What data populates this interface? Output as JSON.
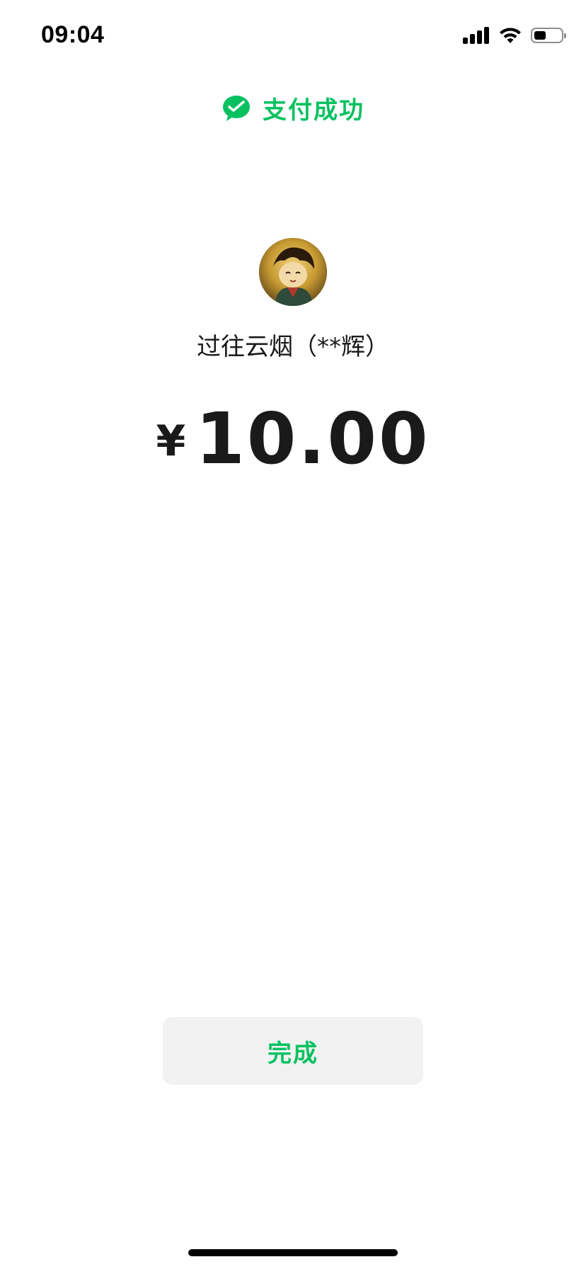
{
  "status_bar": {
    "time": "09:04",
    "battery_level": 0.45,
    "signal_bars": 4
  },
  "header": {
    "title": "支付成功",
    "icon": "wechat-pay-check-icon",
    "accent_color": "#07c160"
  },
  "payee": {
    "name": "过往云烟（**辉）",
    "avatar": "anime-character-avatar"
  },
  "payment": {
    "currency_symbol": "¥",
    "amount": "10.00"
  },
  "actions": {
    "done_label": "完成"
  }
}
